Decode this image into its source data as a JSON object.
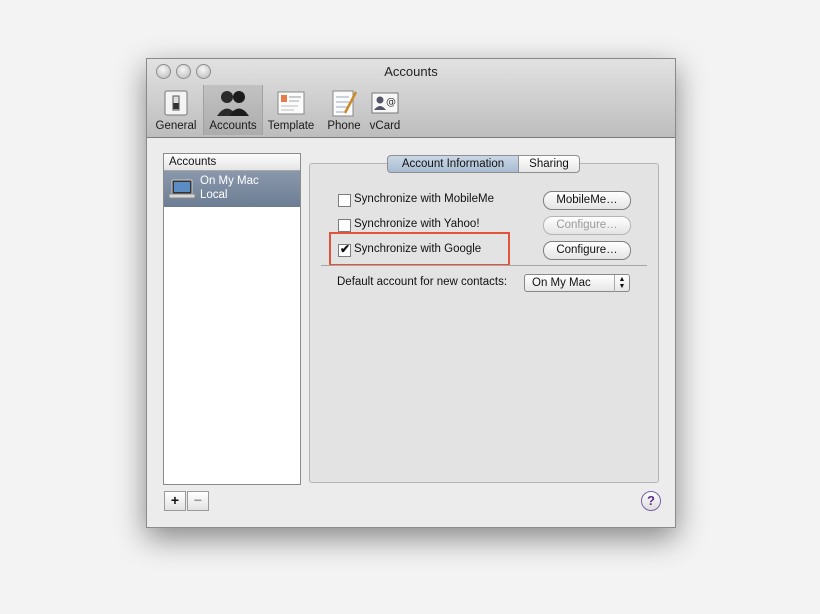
{
  "window": {
    "title": "Accounts"
  },
  "toolbar": {
    "items": [
      {
        "label": "General",
        "icon": "switch-icon"
      },
      {
        "label": "Accounts",
        "icon": "people-icon",
        "selected": true
      },
      {
        "label": "Template",
        "icon": "card-template-icon"
      },
      {
        "label": "Phone",
        "icon": "notepad-pencil-icon"
      },
      {
        "label": "vCard",
        "icon": "vcard-icon"
      }
    ]
  },
  "sidebar": {
    "header": "Accounts",
    "items": [
      {
        "name": "On My Mac",
        "subtitle": "Local",
        "selected": true
      }
    ],
    "add_label": "+",
    "remove_label": "−"
  },
  "tabs": {
    "items": [
      {
        "label": "Account Information",
        "active": true
      },
      {
        "label": "Sharing",
        "active": false
      }
    ]
  },
  "sync": {
    "mobileme": {
      "label": "Synchronize with MobileMe",
      "checked": false,
      "button": "MobileMe…",
      "button_enabled": true
    },
    "yahoo": {
      "label": "Synchronize with Yahoo!",
      "checked": false,
      "button": "Configure…",
      "button_enabled": false
    },
    "google": {
      "label": "Synchronize with Google",
      "checked": true,
      "button": "Configure…",
      "button_enabled": true
    }
  },
  "default_account": {
    "label": "Default account for new contacts:",
    "value": "On My Mac"
  },
  "help_label": "?",
  "colors": {
    "highlight": "#e0543c",
    "selection": "#7585a0"
  }
}
